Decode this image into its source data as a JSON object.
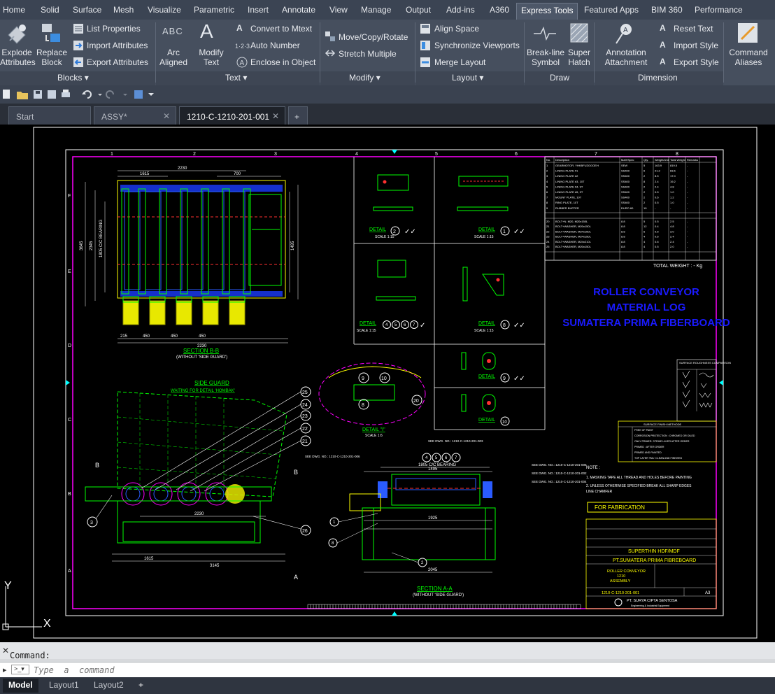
{
  "menu": [
    "Home",
    "Solid",
    "Surface",
    "Mesh",
    "Visualize",
    "Parametric",
    "Insert",
    "Annotate",
    "View",
    "Manage",
    "Output",
    "Add-ins",
    "A360",
    "Express Tools",
    "Featured Apps",
    "BIM 360",
    "Performance"
  ],
  "ribbon": {
    "explode": [
      "Explode",
      "Attributes"
    ],
    "replace": [
      "Replace",
      "Block"
    ],
    "list_properties": "List Properties",
    "import_attributes": "Import Attributes",
    "export_attributes": "Export Attributes",
    "blocks_label": "Blocks",
    "arc_aligned": [
      "Arc",
      "Aligned"
    ],
    "modify_text": [
      "Modify",
      "Text"
    ],
    "convert_mtext": "Convert to Mtext",
    "auto_number": "Auto Number",
    "enclose": "Enclose in Object",
    "text_label": "Text",
    "move_copy_rotate": "Move/Copy/Rotate",
    "stretch_multiple": "Stretch Multiple",
    "modify_label": "Modify",
    "align_space": "Align Space",
    "sync_viewports": "Synchronize Viewports",
    "merge_layout": "Merge Layout",
    "layout_label": "Layout",
    "break_line": [
      "Break-line",
      "Symbol"
    ],
    "super_hatch": [
      "Super",
      "Hatch"
    ],
    "draw_label": "Draw",
    "annotation_attachment": [
      "Annotation",
      "Attachment"
    ],
    "reset_text": "Reset Text",
    "import_style": "Import Style",
    "export_style": "Export Style",
    "dimension_label": "Dimension",
    "command_aliases": [
      "Command",
      "Aliases"
    ]
  },
  "doc_tabs": [
    {
      "label": "Start"
    },
    {
      "label": "ASSY*"
    },
    {
      "label": "1210-C-1210-201-001"
    }
  ],
  "drawing": {
    "title_lines": [
      "ROLLER CONVEYOR",
      "MATERIAL LOG",
      "SUMATERA PRIMA FIBERBOARD"
    ],
    "section_bb": "SECTION  B-B",
    "section_bb_sub": "(WITHOUT 'SIDE GUARD')",
    "section_aa": "SECTION  A-A",
    "section_aa_sub": "(WITHOUT 'SIDE GUARD')",
    "side_guard": "SIDE GUARD",
    "side_guard_sub": "WAITING FOR DETAIL 'HOMBAK'",
    "detail": "DETAIL",
    "detail_i": "DETAIL \"I\"",
    "scale": "SCALE 1:15",
    "scale_i": "SCALE 1:6",
    "total_weight": "TOTAL WEIGHT :  -  Kg",
    "for_fabrication": "FOR FABRICATION",
    "note_title": "NOTE :",
    "notes": [
      "1. MASKING TAPE ALL THREAD AND HOLES BEFORE PAINTING",
      "2. UNLESS OTHERWISE SPECIFIED BREAK ALL SHARP EDGES",
      "    LINE CHAMFER"
    ],
    "project": "SUPERTHIN HDF/MDF",
    "client": "PT.SUMATERA PRIMA FIBREBOARD",
    "title_block": [
      "ROLLER CONVEYOR",
      "1210",
      "ASSEMBLY"
    ],
    "dwg_no": "1210-C-1210-201-001",
    "sheet_size": "A3",
    "company": "PT. SURYA CIPTA SENTOSA",
    "company_sub": "Engineering & Industrial Equipment",
    "surface_roughness": "SURFACE ROUGHNESS COMPARISON",
    "surface_finish": "SURFACE FINISH METHODE",
    "finish_items": [
      "FREE OF PAINT",
      "CORROSION PROTECTION : CHROMED OR OILED",
      "ONLY PRIMER. STRIKE LAYER AFTER ORDER",
      "PRIMED : AFTER ORDER",
      "PRIMED AND PAINTED",
      "TOP LAYER 'RAL' CLEAN AND FINISHED"
    ],
    "balloons_left": [
      "25",
      "24",
      "23",
      "22",
      "21",
      "26"
    ],
    "dims": [
      "2230",
      "1615",
      "700",
      "450",
      "215",
      "3645",
      "2345",
      "1395",
      "1805 C/C BEARING",
      "1495",
      "1925",
      "2045",
      "1615",
      "2230",
      "3145"
    ],
    "bom_header": [
      "No.",
      "Description",
      "Mat'l/Spec",
      "Qty.",
      "Weight/Unit",
      "Total Weight",
      "Remarks"
    ],
    "bom_rows": [
      [
        "1",
        "GEARMOTOR, YHKBFUZGGGEH",
        "SEW",
        "5",
        "163.9",
        "819.5",
        "-"
      ],
      [
        "2",
        "LINING PLATE #1",
        "SS400",
        "6",
        "21.2",
        "63.6",
        "-"
      ],
      [
        "3",
        "LINING PLATE #2",
        "SS400",
        "2",
        "8.5",
        "17.0",
        "-"
      ],
      [
        "4",
        "LINING PLATE #3, 10T",
        "SS400",
        "8",
        "2.4",
        "19.2",
        "-"
      ],
      [
        "5",
        "LINING PLATE #4, 9T",
        "SS400",
        "2",
        "2.4",
        "4.8",
        "-"
      ],
      [
        "6",
        "LINING PLATE #5, 9T",
        "SS400",
        "2",
        "0.5",
        "1.0",
        "-"
      ],
      [
        "7",
        "MOUNT PLATE, 10T",
        "SS400",
        "2",
        "0.6",
        "1.2",
        "-"
      ],
      [
        "8",
        "RING PLATE, 10T",
        "SS400",
        "2",
        "0.5",
        "1.0",
        "-"
      ],
      [
        "9",
        "RUBBER BUFFER",
        "DURO 60",
        "10",
        "-",
        "-",
        "-"
      ],
      [
        "20",
        "BOLT+N. M20, M20x150L",
        "8.8",
        "5",
        "0.5",
        "2.5",
        "-"
      ],
      [
        "21",
        "BOLT+WASHER, M20x150L",
        "8.8",
        "12",
        "0.4",
        "4.8",
        "-"
      ],
      [
        "22",
        "BOLT+WASHER, M24x160L",
        "8.8",
        "6",
        "0.5",
        "3.0",
        "-"
      ],
      [
        "23",
        "BOLT+WASHER, M24x150L",
        "8.8",
        "4",
        "0.6",
        "2.4",
        "-"
      ],
      [
        "24",
        "BOLT+WASHER, M24x210L",
        "8.8",
        "4",
        "0.6",
        "2.4",
        "-"
      ],
      [
        "25",
        "BOLT+WASHER, M20x150L",
        "8.8",
        "4",
        "0.5",
        "2.0",
        "-"
      ]
    ],
    "ruler_top": [
      "1",
      "2",
      "3",
      "4",
      "5",
      "6",
      "7",
      "8"
    ],
    "ruler_side": [
      "F",
      "E",
      "D",
      "C",
      "B",
      "A"
    ],
    "see_dwg": [
      "SEE DWG. NO.: 1210-C-1210-201-003",
      "SEE DWG. NO.: 1210-C-1210-201-005",
      "SEE DWG. NO.: 1210-C-1210-201-002",
      "SEE DWG. NO.: 1210-C-1210-201-004",
      "SEE DWG. NO.: 1210-C-1210-201-006"
    ]
  },
  "ucs": {
    "y": "Y",
    "x": "X"
  },
  "command": {
    "label": "Command:",
    "placeholder": "Type  a  command"
  },
  "layout_tabs": [
    "Model",
    "Layout1",
    "Layout2"
  ],
  "colors": {
    "menubar": "#3b4453",
    "ribbon": "#464f5e",
    "title": "#1414ff",
    "frame": "#ff00ff",
    "sheet_border": "#ffffff",
    "yellow": "#ffff00",
    "cyan": "#00ffff",
    "green": "#00ff00",
    "blue": "#2a5bff"
  }
}
